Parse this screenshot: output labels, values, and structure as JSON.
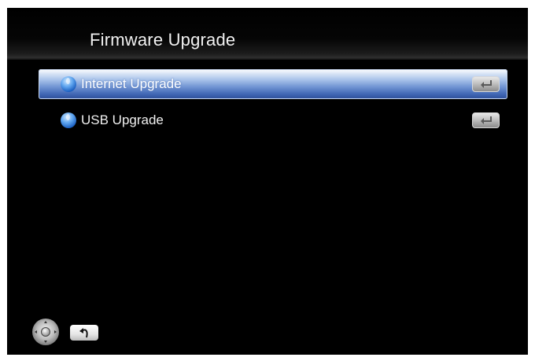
{
  "header": {
    "title": "Firmware Upgrade"
  },
  "menu": {
    "items": [
      {
        "label": "Internet Upgrade",
        "selected": true,
        "icon": "blue-orb-icon",
        "action_icon": "enter-key-icon"
      },
      {
        "label": "USB Upgrade",
        "selected": false,
        "icon": "blue-orb-icon",
        "action_icon": "enter-key-icon"
      }
    ]
  },
  "footer": {
    "nav_icon": "dpad-navigation-icon",
    "back_icon": "return-arrow-icon"
  },
  "colors": {
    "background": "#000000",
    "selection_top": "#dfe9f7",
    "selection_bottom": "#2d4f99",
    "text": "#f0f0f0"
  }
}
